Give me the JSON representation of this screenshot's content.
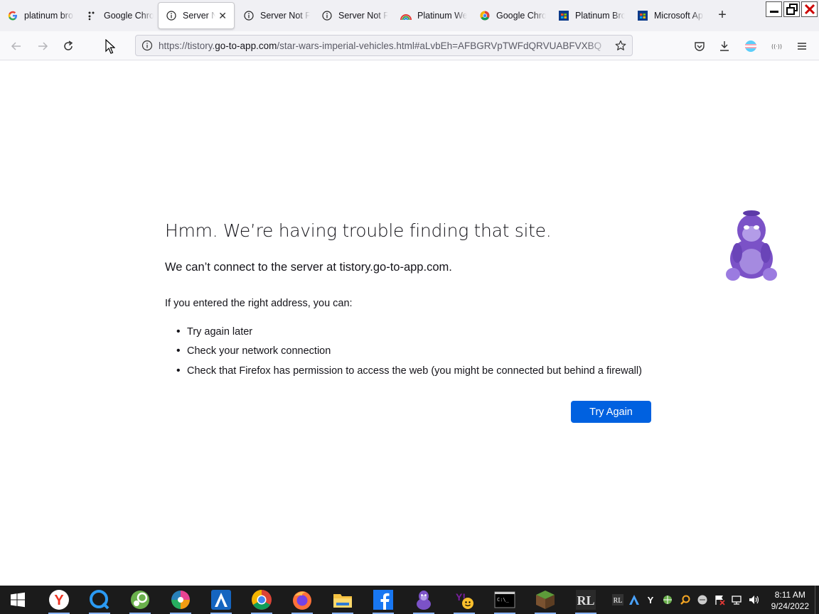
{
  "browser": {
    "tabs": [
      {
        "label": "platinum bro",
        "icon": "google-g-icon"
      },
      {
        "label": "Google Chro",
        "icon": "dots-icon"
      },
      {
        "label": "Server Not F",
        "icon": "info-icon",
        "active": true
      },
      {
        "label": "Server Not F",
        "icon": "info-icon"
      },
      {
        "label": "Server Not F",
        "icon": "info-icon"
      },
      {
        "label": "Platinum We",
        "icon": "rainbow-icon"
      },
      {
        "label": "Google Chro",
        "icon": "chrome-icon"
      },
      {
        "label": "Platinum Bro",
        "icon": "store-icon"
      },
      {
        "label": "Microsoft Ap",
        "icon": "store-icon"
      }
    ],
    "url_prefix": "https://tistory.",
    "url_host": "go-to-app.com",
    "url_path": "/star-wars-imperial-vehicles.html#aLvbEh=AFBGRVpTWFdQRVUABFVXBQ"
  },
  "error_page": {
    "title": "Hmm. We’re having trouble finding that site.",
    "subtitle": "We can’t connect to the server at tistory.go-to-app.com.",
    "intro": "If you entered the right address, you can:",
    "suggestions": [
      "Try again later",
      "Check your network connection",
      "Check that Firefox has permission to access the web (you might be connected but behind a firewall)"
    ],
    "try_again_label": "Try Again"
  },
  "taskbar": {
    "apps": [
      "windows-start-icon",
      "yandex-icon",
      "cortana-icon",
      "steam-icon",
      "color-wheel-icon",
      "a-icon",
      "chrome-icon",
      "firefox-icon",
      "file-explorer-icon",
      "facebook-icon",
      "bonzi-icon",
      "yahoo-icon",
      "terminal-icon",
      "minecraft-icon",
      "rl-icon"
    ],
    "time": "8:11 AM",
    "date": "9/24/2022"
  },
  "colors": {
    "accent": "#0061e0",
    "tab_bg": "#f0f0f4",
    "taskbar_bg": "#1b1b1b"
  }
}
